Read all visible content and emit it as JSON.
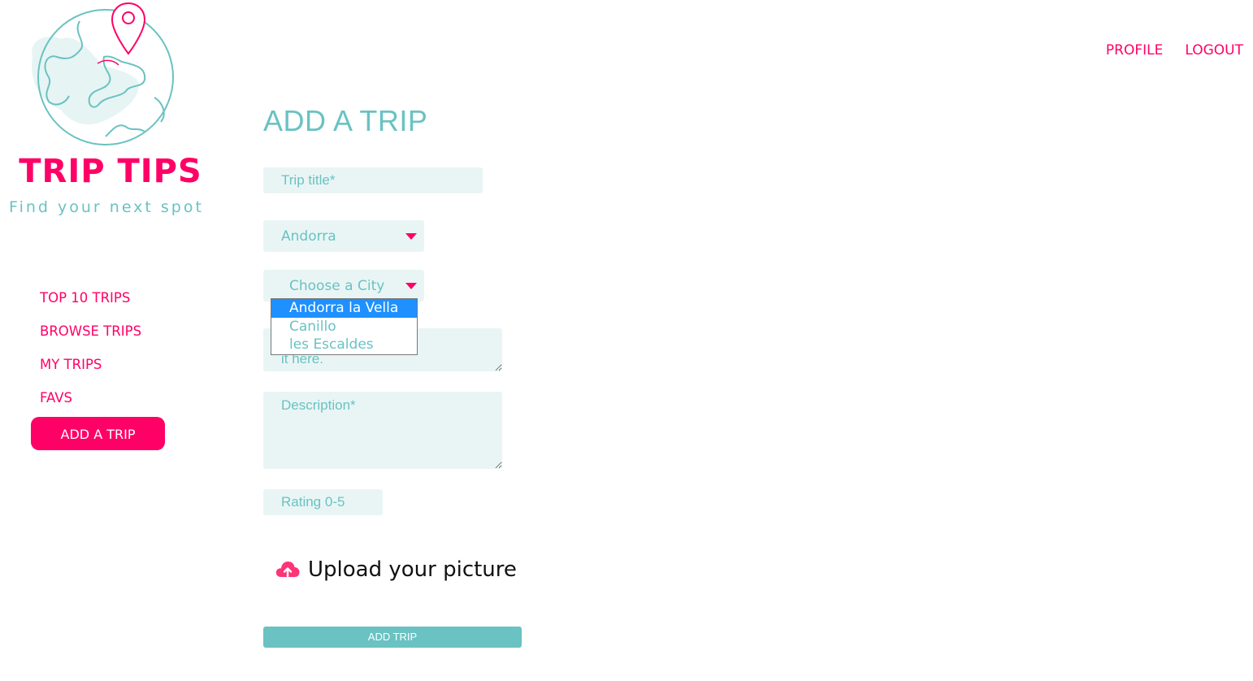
{
  "brand": {
    "name": "TRIP TIPS",
    "tagline": "Find your next spot"
  },
  "topnav": {
    "profile": "PROFILE",
    "logout": "LOGOUT"
  },
  "sidebar": {
    "items": [
      {
        "label": "TOP 10 TRIPS"
      },
      {
        "label": "BROWSE TRIPS"
      },
      {
        "label": "MY TRIPS"
      },
      {
        "label": "FAVS"
      }
    ],
    "add_trip_label": "ADD A TRIP"
  },
  "form": {
    "heading": "ADD A TRIP",
    "title_placeholder": "Trip title*",
    "country_value": "Andorra",
    "city_placeholder": "Choose a City",
    "city_options": [
      "Andorra la Vella",
      "Canillo",
      "les Escaldes"
    ],
    "city_highlighted": "Andorra la Vella",
    "location_placeholder_visible": "ation? Add\nit here.",
    "description_placeholder": "Description*",
    "rating_placeholder": "Rating 0-5",
    "upload_label": "Upload your picture",
    "submit_label": "ADD TRIP"
  },
  "colors": {
    "accent": "#ff0066",
    "teal": "#6ac2c2",
    "field_bg": "#e9f5f5",
    "highlight": "#1e90ff"
  },
  "icons": {
    "logo": "globe-with-map-pin",
    "upload": "cloud-upload-icon",
    "dropdown": "caret-down-icon"
  }
}
